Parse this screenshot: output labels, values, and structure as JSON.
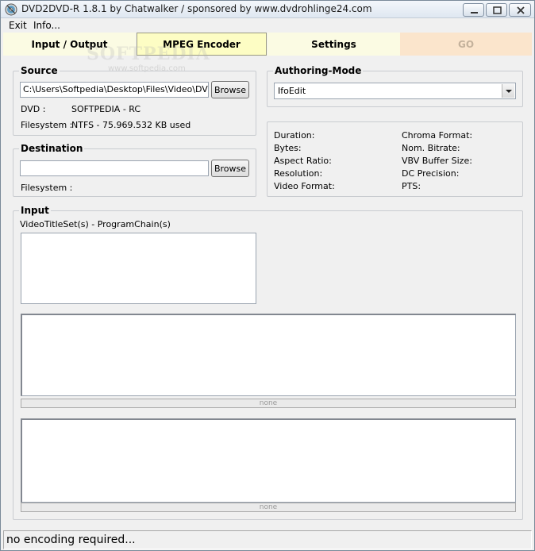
{
  "window": {
    "title": "DVD2DVD-R 1.8.1 by Chatwalker   /   sponsored by www.dvdrohlinge24.com"
  },
  "menu": {
    "exit": "Exit",
    "info": "Info..."
  },
  "tabs": [
    {
      "label": "Input / Output"
    },
    {
      "label": "MPEG Encoder"
    },
    {
      "label": "Settings"
    },
    {
      "label": "GO"
    }
  ],
  "watermark": {
    "main": "SOFTPEDIA",
    "sub": "www.softpedia.com"
  },
  "source": {
    "title": "Source",
    "path_value": "C:\\Users\\Softpedia\\Desktop\\Files\\Video\\DVD_D",
    "browse_label": "Browse",
    "dvd_label": "DVD :",
    "dvd_value": "SOFTPEDIA - RC",
    "filesystem_label": "Filesystem :",
    "filesystem_value": "NTFS - 75.969.532 KB used"
  },
  "destination": {
    "title": "Destination",
    "path_value": "",
    "browse_label": "Browse",
    "filesystem_label": "Filesystem :"
  },
  "authoring": {
    "title": "Authoring-Mode",
    "selected": "IfoEdit"
  },
  "info": {
    "left": [
      "Duration:",
      "Bytes:",
      "Aspect Ratio:",
      "Resolution:",
      "Video Format:"
    ],
    "right": [
      "Chroma Format:",
      "Nom. Bitrate:",
      "VBV Buffer Size:",
      "DC Precision:",
      "PTS:"
    ]
  },
  "input": {
    "title": "Input",
    "list_label": "VideoTitleSet(s) - ProgramChain(s)",
    "progress1": "none",
    "progress2": "none"
  },
  "status": {
    "text": "no encoding required..."
  }
}
